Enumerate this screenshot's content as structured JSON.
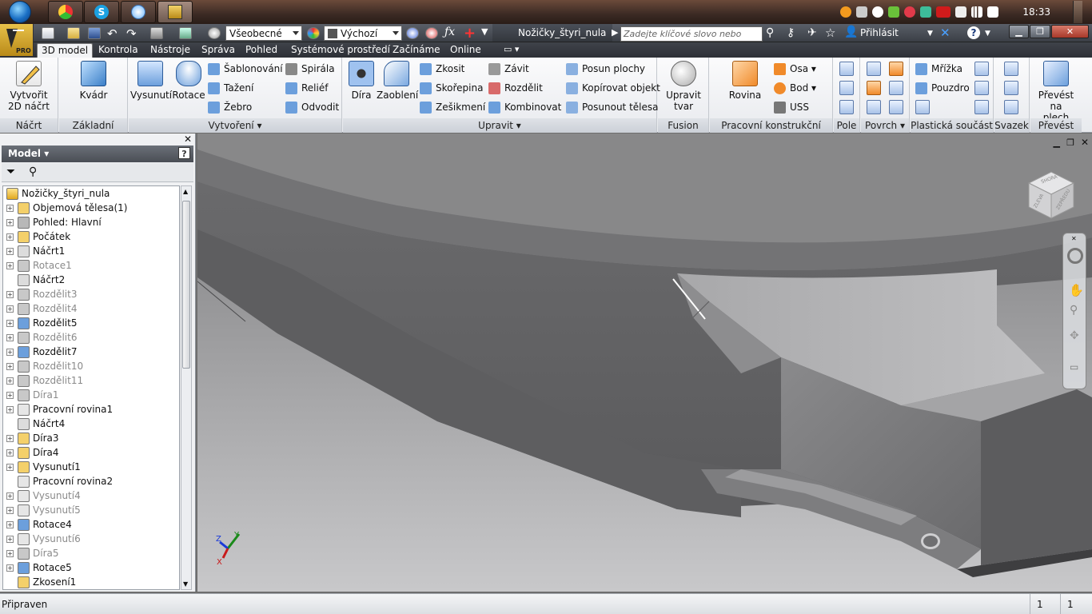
{
  "taskbar": {
    "clock": "18:33",
    "tray_icons": [
      "orange-circle-icon",
      "flag-icon",
      "bluetooth-icon",
      "leaf-icon",
      "power-icon",
      "chart-icon",
      "ati-icon",
      "usb-icon",
      "network-icon",
      "volume-icon"
    ]
  },
  "qat": {
    "style_combo": "Všeobecné",
    "appearance_combo": "Výchozí",
    "doc_title": "Nožičky_štyri_nula",
    "search_placeholder": "Zadejte klíčové slovo nebo výraz.",
    "login": "Přihlásit",
    "app_badge": "PRO"
  },
  "tabs": [
    "3D model",
    "Kontrola",
    "Nástroje",
    "Správa",
    "Pohled",
    "Systémové prostředí",
    "Začínáme",
    "Online"
  ],
  "ribbon": {
    "sketch": {
      "label": "Náčrt",
      "btn1": "Vytvořit",
      "btn2": "2D náčrt"
    },
    "primitives": {
      "label": "Základní tělesa",
      "btn": "Kvádr"
    },
    "create": {
      "label": "Vytvoření",
      "big": [
        "Vysunutí",
        "Rotace"
      ],
      "col1": [
        "Šablonování",
        "Tažení",
        "Žebro"
      ],
      "col2": [
        "Spirála",
        "Reliéf",
        "Odvodit"
      ]
    },
    "modify": {
      "label": "Upravit",
      "big": [
        "Díra",
        "Zaoblení"
      ],
      "col1": [
        "Zkosit",
        "Skořepina",
        "Zešikmení"
      ],
      "col2": [
        "Závit",
        "Rozdělit",
        "Kombinovat"
      ],
      "col3": [
        "Posun plochy",
        "Kopírovat objekt",
        "Posunout tělesa"
      ]
    },
    "fusion": {
      "label": "Fusion",
      "btn1": "Upravit",
      "btn2": "tvar"
    },
    "work": {
      "label": "Pracovní konstrukční prvky",
      "big": "Rovina",
      "col": [
        "Osa",
        "Bod",
        "USS"
      ]
    },
    "pattern": {
      "label": "Pole"
    },
    "surface": {
      "label": "Povrch"
    },
    "plastic": {
      "label": "Plastická součást",
      "col": [
        "Mřížka",
        "Pouzdro"
      ]
    },
    "harness": {
      "label": "Svazek"
    },
    "convert": {
      "label": "Převést",
      "btn1": "Převést na",
      "btn2": "plech"
    }
  },
  "browser": {
    "title": "Model",
    "root": "Nožičky_štyri_nula",
    "nodes": [
      {
        "label": "Objemová tělesa(1)",
        "dim": false,
        "exp": true
      },
      {
        "label": "Pohled: Hlavní",
        "dim": false,
        "exp": true
      },
      {
        "label": "Počátek",
        "dim": false,
        "exp": true
      },
      {
        "label": "Náčrt1",
        "dim": false,
        "exp": true
      },
      {
        "label": "Rotace1",
        "dim": true,
        "exp": true
      },
      {
        "label": "Náčrt2",
        "dim": false,
        "exp": false
      },
      {
        "label": "Rozdělit3",
        "dim": true,
        "exp": true
      },
      {
        "label": "Rozdělit4",
        "dim": true,
        "exp": true
      },
      {
        "label": "Rozdělit5",
        "dim": false,
        "exp": true
      },
      {
        "label": "Rozdělit6",
        "dim": true,
        "exp": true
      },
      {
        "label": "Rozdělit7",
        "dim": false,
        "exp": true
      },
      {
        "label": "Rozdělit10",
        "dim": true,
        "exp": true
      },
      {
        "label": "Rozdělit11",
        "dim": true,
        "exp": true
      },
      {
        "label": "Díra1",
        "dim": true,
        "exp": true
      },
      {
        "label": "Pracovní rovina1",
        "dim": false,
        "exp": true
      },
      {
        "label": "Náčrt4",
        "dim": false,
        "exp": false
      },
      {
        "label": "Díra3",
        "dim": false,
        "exp": true
      },
      {
        "label": "Díra4",
        "dim": false,
        "exp": true
      },
      {
        "label": "Vysunutí1",
        "dim": false,
        "exp": true
      },
      {
        "label": "Pracovní rovina2",
        "dim": false,
        "exp": false
      },
      {
        "label": "Vysunutí4",
        "dim": true,
        "exp": true
      },
      {
        "label": "Vysunutí5",
        "dim": true,
        "exp": true
      },
      {
        "label": "Rotace4",
        "dim": false,
        "exp": true
      },
      {
        "label": "Vysunutí6",
        "dim": true,
        "exp": true
      },
      {
        "label": "Díra5",
        "dim": true,
        "exp": true
      },
      {
        "label": "Rotace5",
        "dim": false,
        "exp": true
      },
      {
        "label": "Zkosení1",
        "dim": false,
        "exp": false
      }
    ]
  },
  "viewcube": {
    "face1": "SHORA",
    "face2": "ZLEVA",
    "face3": "ZEPŘEDU"
  },
  "status": {
    "text": "Připraven",
    "count1": "1",
    "count2": "1"
  }
}
